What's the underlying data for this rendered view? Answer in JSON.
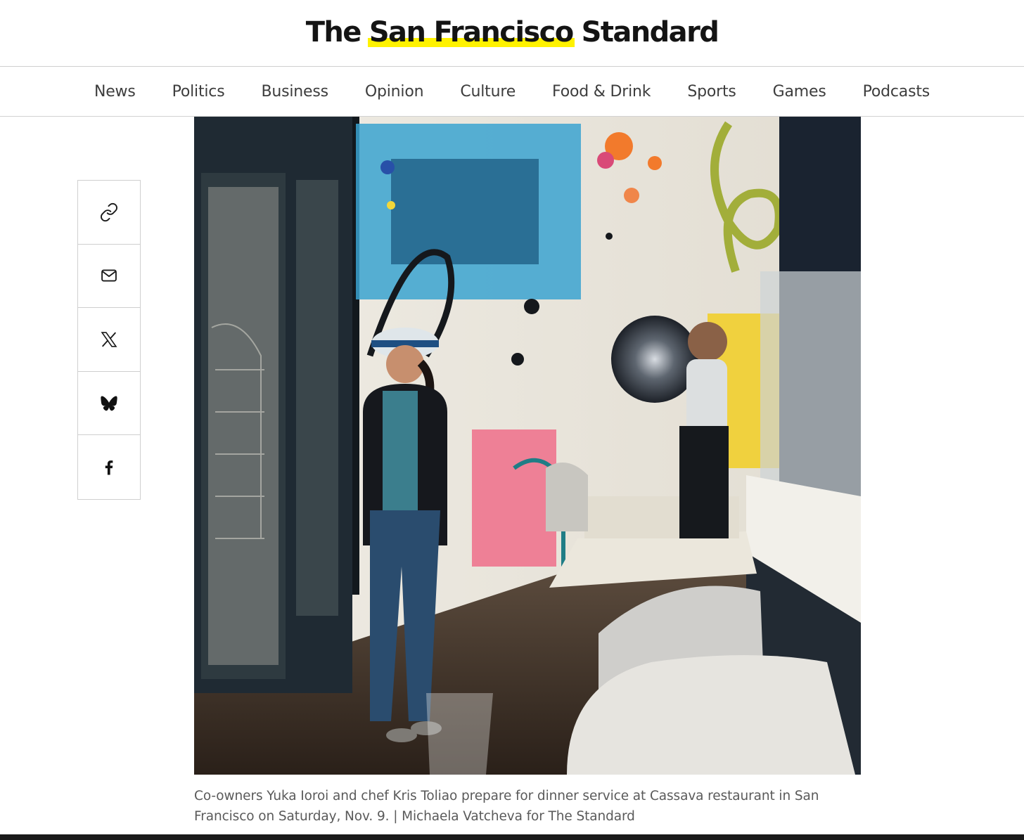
{
  "masthead": {
    "title_prefix": "The",
    "title_highlight": "San Francisco",
    "title_suffix": "Standard",
    "highlight_color": "#fff200"
  },
  "nav": {
    "items": [
      "News",
      "Politics",
      "Business",
      "Opinion",
      "Culture",
      "Food & Drink",
      "Sports",
      "Games",
      "Podcasts"
    ]
  },
  "share": {
    "icons": [
      "link-icon",
      "mail-icon",
      "x-icon",
      "bluesky-icon",
      "facebook-icon"
    ]
  },
  "article": {
    "caption": "Co-owners Yuka Ioroi and chef Kris Toliao prepare for dinner service at Cassava restaurant in San Francisco on Saturday, Nov. 9. | Michaela Vatcheva for The Standard"
  }
}
